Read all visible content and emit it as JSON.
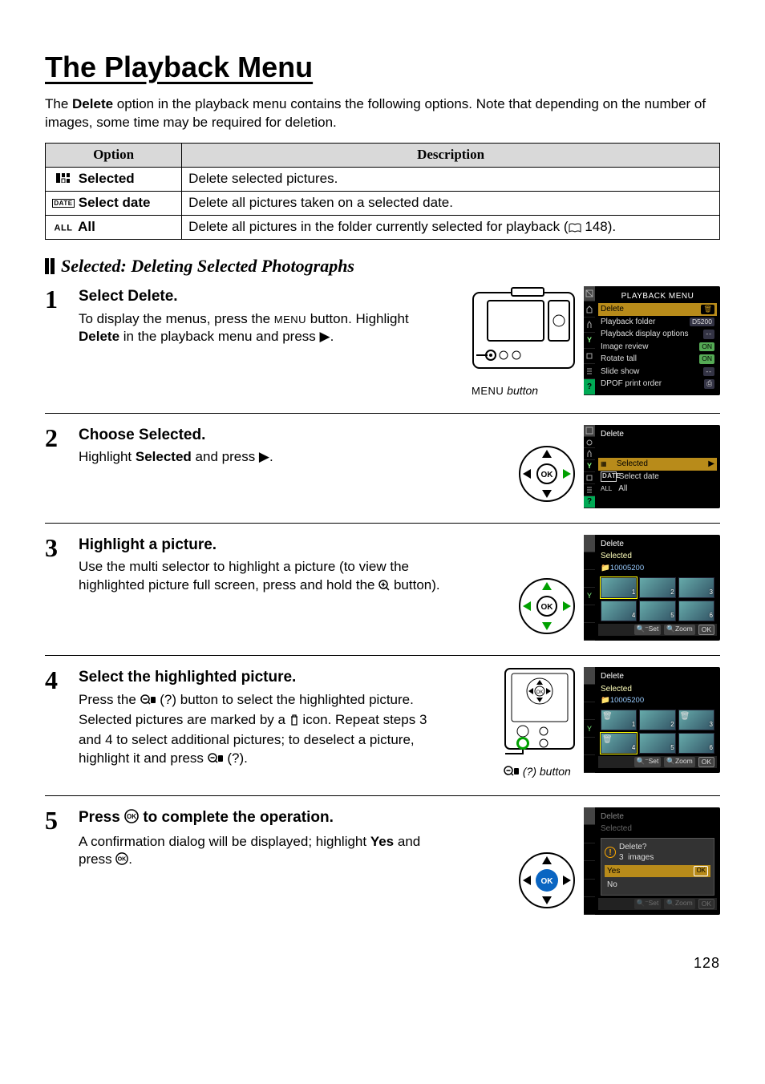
{
  "page": {
    "title": "The Playback Menu",
    "intro_before_bold": "The ",
    "intro_bold": "Delete",
    "intro_after_bold": " option in the playback menu contains the following options.  Note that depending on the number of images, some time may be required for deletion.",
    "page_number": "128"
  },
  "options_table": {
    "head_option": "Option",
    "head_description": "Description",
    "rows": [
      {
        "icon": "grid",
        "name": "Selected",
        "desc": "Delete selected pictures."
      },
      {
        "icon": "date-box",
        "name": "Select date",
        "desc": "Delete all pictures taken on a selected date."
      },
      {
        "icon": "all",
        "name": "All",
        "desc_before_ref": "Delete all pictures in the folder currently selected for playback (",
        "desc_ref": "148",
        "desc_after_ref": ")."
      }
    ]
  },
  "section": {
    "heading": "Selected: Deleting Selected Photographs"
  },
  "steps": [
    {
      "num": "1",
      "title": "Select Delete.",
      "body_parts": [
        "To display the menus, press the ",
        "MENU",
        " button. Highlight ",
        "Delete",
        " in the playback menu and press ▶."
      ],
      "caption_parts": [
        "MENU",
        " button"
      ]
    },
    {
      "num": "2",
      "title": "Choose Selected.",
      "body_parts": [
        "Highlight ",
        "Selected",
        " and press ▶."
      ]
    },
    {
      "num": "3",
      "title": "Highlight a picture.",
      "body_plain": "Use the multi selector to highlight a picture (to view the highlighted picture full screen, press and hold the ",
      "body_tail": " button)."
    },
    {
      "num": "4",
      "title": "Select the highlighted picture.",
      "body_a": "Press the ",
      "body_b": " (?) button to select the highlighted picture.  Selected pictures are marked by a ",
      "body_c": " icon.  Repeat steps 3 and 4 to select additional pictures; to deselect a picture, highlight it and press ",
      "body_d": " (?).",
      "caption": " (?) button"
    },
    {
      "num": "5",
      "title_a": "Press ",
      "title_b": " to complete the operation.",
      "body_parts": [
        "A confirmation dialog will be displayed; highlight ",
        "Yes",
        " and press "
      ]
    }
  ],
  "lcd": {
    "playback_menu": {
      "title": "PLAYBACK MENU",
      "items": [
        {
          "label": "Delete",
          "badge": "trash"
        },
        {
          "label": "Playback folder",
          "badge": "D5200"
        },
        {
          "label": "Playback display options",
          "badge": "--"
        },
        {
          "label": "Image review",
          "badge": "ON"
        },
        {
          "label": "Rotate tall",
          "badge": "ON"
        },
        {
          "label": "Slide show",
          "badge": "--"
        },
        {
          "label": "DPOF print order",
          "badge": "print"
        }
      ]
    },
    "delete_menu": {
      "title": "Delete",
      "items": [
        {
          "pref": "grid",
          "label": "Selected",
          "hi": true
        },
        {
          "pref": "date-box",
          "label": "Select date"
        },
        {
          "pref": "all",
          "label": "All"
        }
      ]
    },
    "thumbs": {
      "title": "Delete",
      "subtitle": "Selected",
      "folder": "10005200",
      "buttons": {
        "set": "Set",
        "zoom": "Zoom",
        "ok": "OK"
      }
    },
    "confirm": {
      "title": "Delete",
      "subtitle": "Selected",
      "question_line1": "Delete?",
      "question_line2_count": "3",
      "question_line2_word": "images",
      "yes": "Yes",
      "no": "No"
    }
  }
}
